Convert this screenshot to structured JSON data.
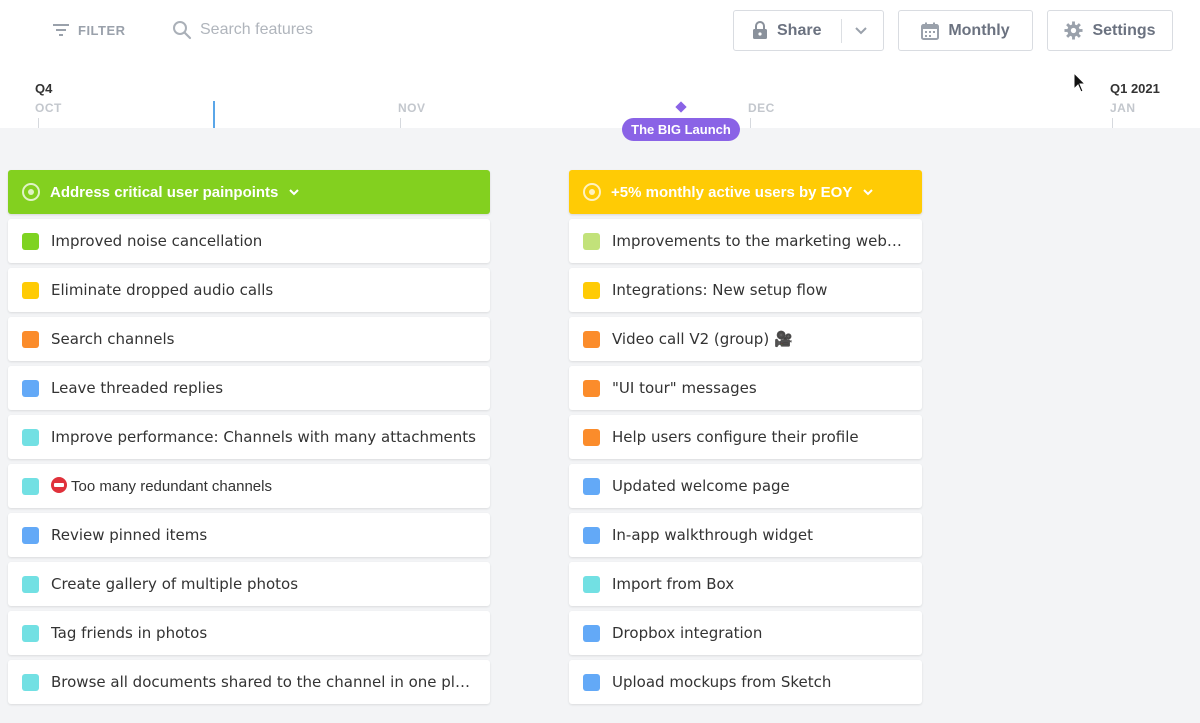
{
  "toolbar": {
    "filter_label": "FILTER",
    "search_placeholder": "Search features",
    "share_label": "Share",
    "monthly_label": "Monthly",
    "settings_label": "Settings"
  },
  "timeline": {
    "quarters": [
      {
        "label": "Q4"
      },
      {
        "label": "Q1 2021"
      }
    ],
    "months": [
      "OCT",
      "NOV",
      "DEC",
      "JAN"
    ],
    "milestone": "The BIG Launch"
  },
  "colors": {
    "goal1": "#83d01f",
    "goal2": "#ffcb05",
    "milestone": "#8a63e6",
    "today_line": "#5aa6e8"
  },
  "columns": [
    {
      "title": "Address critical user painpoints",
      "cards": [
        {
          "label": "Improved noise cancellation",
          "color": "#7ed321"
        },
        {
          "label": "Eliminate dropped audio calls",
          "color": "#ffcb05"
        },
        {
          "label": "Search channels",
          "color": "#fb8c2b"
        },
        {
          "label": "Leave threaded replies",
          "color": "#63a9f7"
        },
        {
          "label": "Improve performance: Channels with many attachments",
          "color": "#72e0e3"
        },
        {
          "label": "Too many redundant channels",
          "color": "#72e0e3",
          "icon": "no-entry-icon"
        },
        {
          "label": "Review pinned items",
          "color": "#63a9f7"
        },
        {
          "label": "Create gallery of multiple photos",
          "color": "#72e0e3"
        },
        {
          "label": "Tag friends in photos",
          "color": "#72e0e3"
        },
        {
          "label": "Browse all documents shared to the channel in one place",
          "color": "#72e0e3"
        }
      ]
    },
    {
      "title": "+5% monthly active users by EOY",
      "cards": [
        {
          "label": "Improvements to the marketing websi…",
          "color": "#c2e27a"
        },
        {
          "label": "Integrations: New setup flow",
          "color": "#ffcb05"
        },
        {
          "label": "Video call V2 (group) 🎥",
          "color": "#fb8c2b"
        },
        {
          "label": "\"UI tour\" messages",
          "color": "#fb8c2b"
        },
        {
          "label": "Help users configure their profile",
          "color": "#fb8c2b"
        },
        {
          "label": "Updated welcome page",
          "color": "#63a9f7"
        },
        {
          "label": "In-app walkthrough widget",
          "color": "#63a9f7"
        },
        {
          "label": "Import from Box",
          "color": "#72e0e3"
        },
        {
          "label": "Dropbox integration",
          "color": "#63a9f7"
        },
        {
          "label": "Upload mockups from Sketch",
          "color": "#63a9f7"
        }
      ]
    }
  ]
}
